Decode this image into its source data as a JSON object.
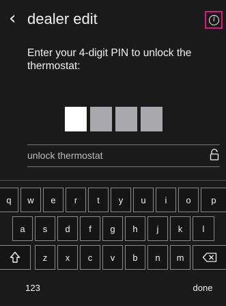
{
  "header": {
    "back_icon": "chevron-left-icon",
    "title": "dealer edit",
    "info_icon": "info-icon",
    "highlight_color": "#e0177e"
  },
  "prompt": "Enter your 4-digit PIN to unlock the thermostat:",
  "pin": {
    "length": 4,
    "entered": 1
  },
  "unlock": {
    "label": "unlock thermostat",
    "icon": "unlock-icon"
  },
  "keyboard": {
    "row1": [
      "q",
      "w",
      "e",
      "r",
      "t",
      "y",
      "u",
      "i",
      "o",
      "p"
    ],
    "row2": [
      "a",
      "s",
      "d",
      "f",
      "g",
      "h",
      "j",
      "k",
      "l"
    ],
    "row3": [
      "z",
      "x",
      "c",
      "v",
      "b",
      "n",
      "m"
    ],
    "shift_icon": "shift-icon",
    "backspace_icon": "backspace-icon",
    "numbers_label": "123",
    "done_label": "done"
  }
}
